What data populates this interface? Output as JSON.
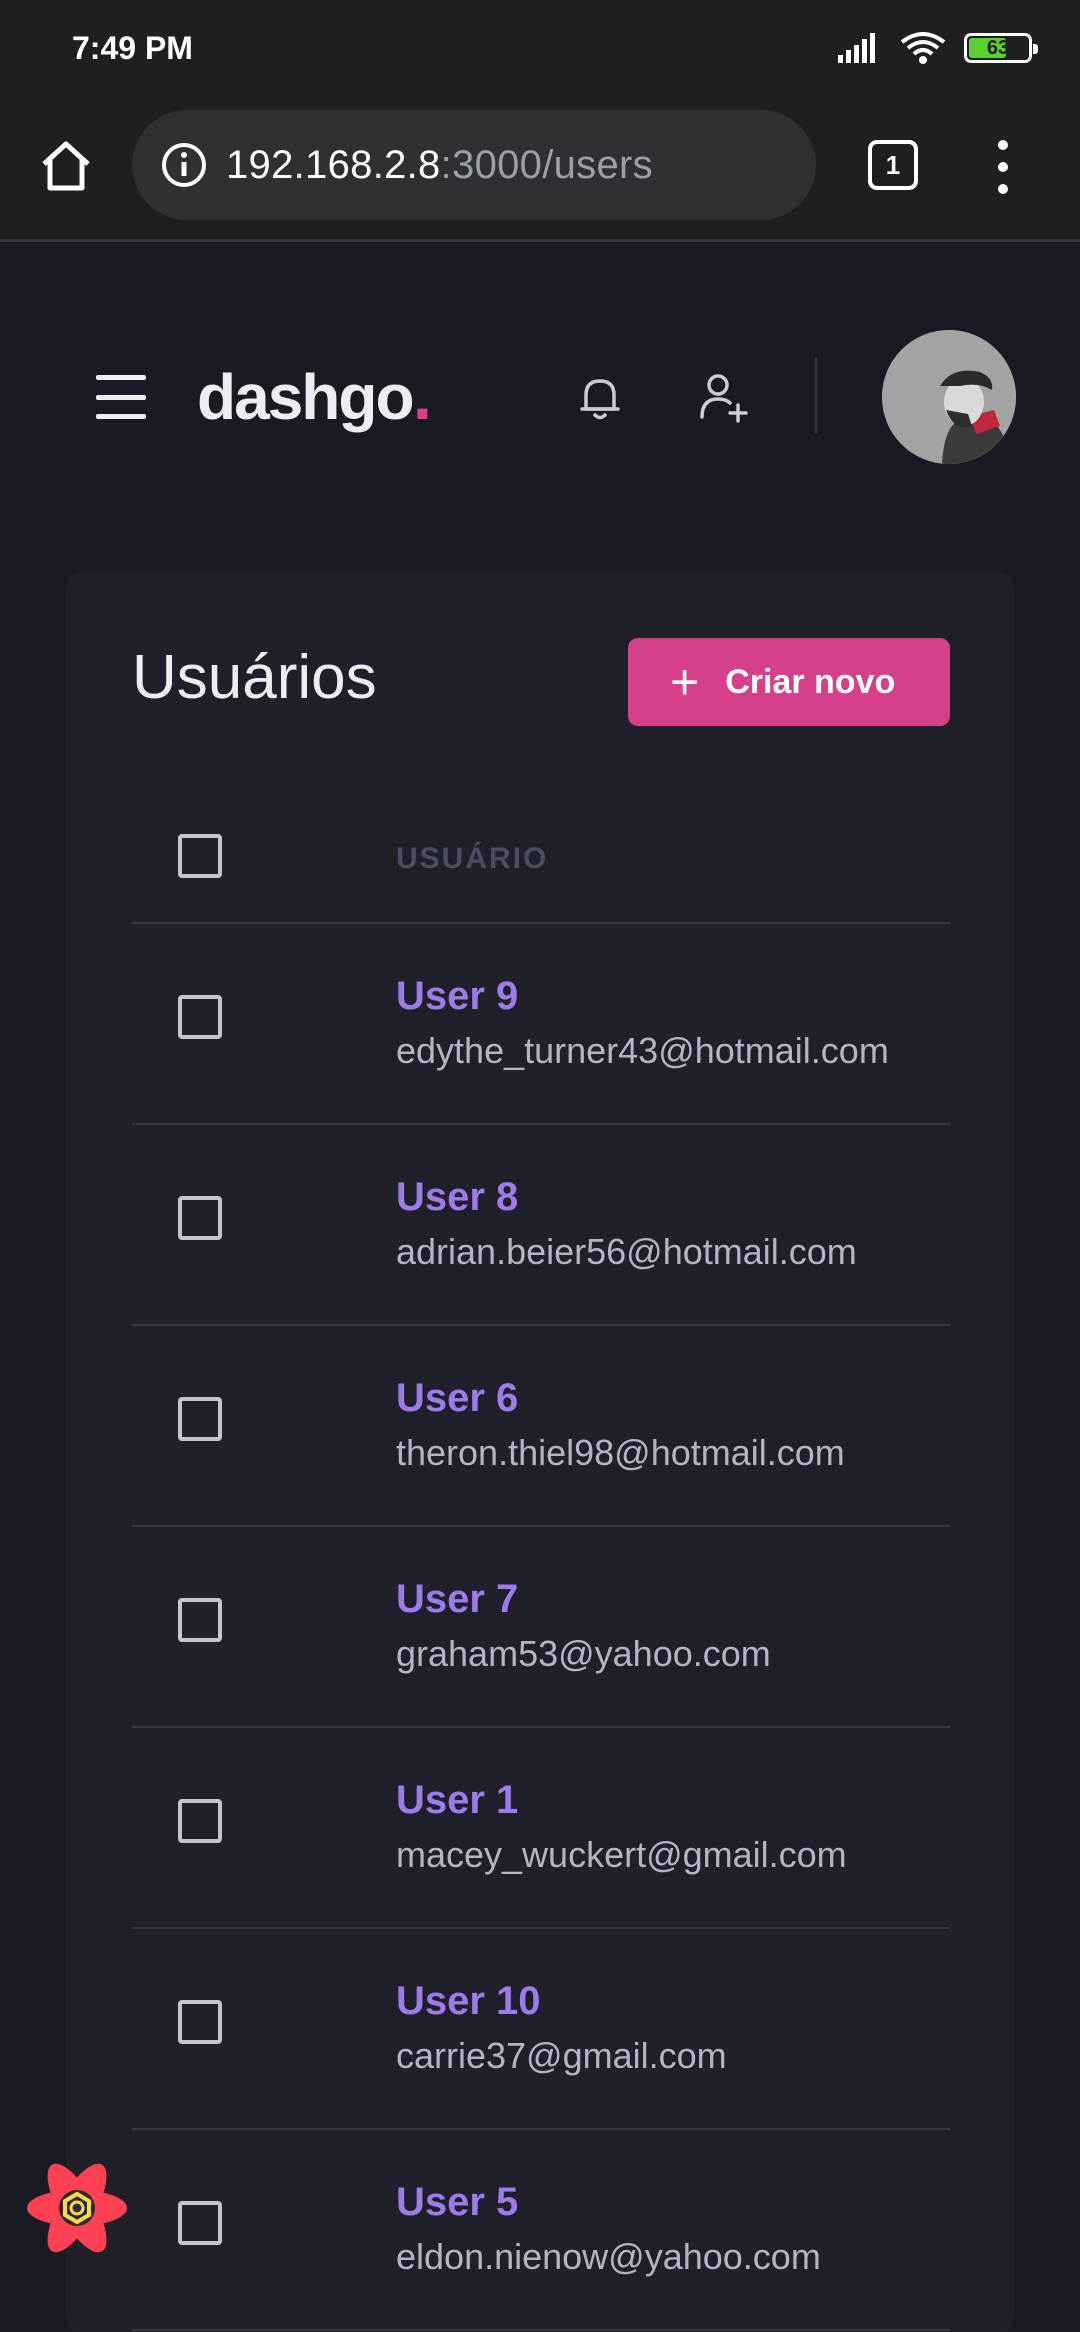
{
  "status_bar": {
    "time": "7:49 PM",
    "battery": "63",
    "battery_level": 0.63
  },
  "browser": {
    "url_host": "192.168.2.8",
    "url_path": ":3000/users",
    "tab_count": "1"
  },
  "header": {
    "logo": "dashgo",
    "logo_dot": ".",
    "accent_color": "#d53f8c"
  },
  "users_panel": {
    "title": "Usuários",
    "create_button": "Criar novo",
    "column_header": "USUÁRIO",
    "rows": [
      {
        "name": "User 9",
        "email": "edythe_turner43@hotmail.com"
      },
      {
        "name": "User 8",
        "email": "adrian.beier56@hotmail.com"
      },
      {
        "name": "User 6",
        "email": "theron.thiel98@hotmail.com"
      },
      {
        "name": "User 7",
        "email": "graham53@yahoo.com"
      },
      {
        "name": "User 1",
        "email": "macey_wuckert@gmail.com"
      },
      {
        "name": "User 10",
        "email": "carrie37@gmail.com"
      },
      {
        "name": "User 5",
        "email": "eldon.nienow@yahoo.com"
      }
    ]
  },
  "colors": {
    "background": "#181b23",
    "card": "#1f2029",
    "user_name": "#9f7aea",
    "primary_button": "#d53f8c"
  },
  "icons": [
    "home-icon",
    "info-icon",
    "menu-icon",
    "bell-icon",
    "user-add-icon",
    "react-devtools-icon"
  ]
}
